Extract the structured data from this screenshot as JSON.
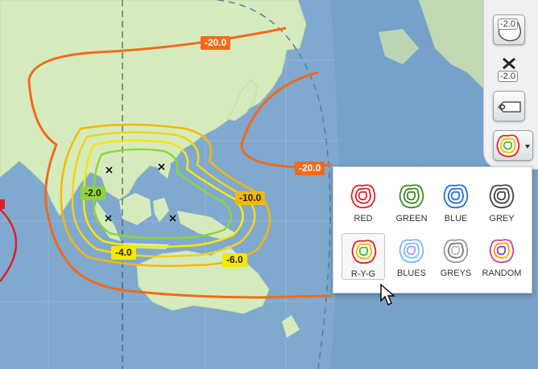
{
  "contours": [
    {
      "label": "-20.0",
      "bg": "#f26a1b",
      "color": "#fff"
    },
    {
      "label": "-20.0",
      "bg": "#f26a1b",
      "color": "#fff"
    },
    {
      "label": "-10.0",
      "bg": "#f5b800",
      "color": "#222"
    },
    {
      "label": "-6.0",
      "bg": "#f6e800",
      "color": "#222"
    },
    {
      "label": "-4.0",
      "bg": "#f6e800",
      "color": "#222"
    },
    {
      "label": "-2.0",
      "bg": "#8fd43a",
      "color": "#222"
    }
  ],
  "toolbar": {
    "contour_value_badge": "-2.0",
    "remove_value_badge": "-2.0"
  },
  "palette_menu": {
    "options": [
      {
        "label": "RED",
        "colors": [
          "#e0202a",
          "#e0202a",
          "#e0202a"
        ]
      },
      {
        "label": "GREEN",
        "colors": [
          "#3f8a1e",
          "#3f8a1e",
          "#3f8a1e"
        ]
      },
      {
        "label": "BLUE",
        "colors": [
          "#1e6fd6",
          "#1e6fd6",
          "#1e6fd6"
        ]
      },
      {
        "label": "GREY",
        "colors": [
          "#444444",
          "#444444",
          "#444444"
        ]
      },
      {
        "label": "R-Y-G",
        "colors": [
          "#e0202a",
          "#f5b800",
          "#3fbf2a"
        ]
      },
      {
        "label": "BLUES",
        "colors": [
          "#7fb3ff",
          "#5dd0ff",
          "#c08cff"
        ]
      },
      {
        "label": "GREYS",
        "colors": [
          "#999999",
          "#777777",
          "#bbbbbb"
        ]
      },
      {
        "label": "RANDOM",
        "colors": [
          "#d43f9a",
          "#f5a300",
          "#7a3fd4"
        ]
      }
    ],
    "selected": "R-Y-G"
  }
}
